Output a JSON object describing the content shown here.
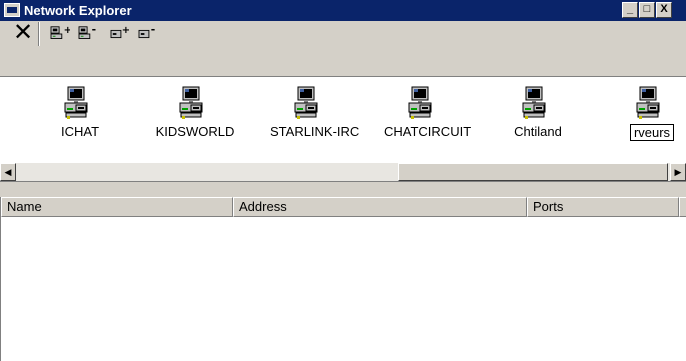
{
  "window": {
    "title": "Network Explorer",
    "minimize_label": "_",
    "maximize_label": "□",
    "close_label": "X"
  },
  "toolbar": {
    "close_label": "✕"
  },
  "servers": [
    {
      "label": "ICHAT"
    },
    {
      "label": "KIDSWORLD"
    },
    {
      "label": "STARLINK-IRC"
    },
    {
      "label": "CHATCIRCUIT"
    },
    {
      "label": "Chtiland"
    },
    {
      "label": "rveurs"
    }
  ],
  "scrollbar": {
    "left_arrow": "◀",
    "right_arrow": "▶"
  },
  "list": {
    "columns": [
      "Name",
      "Address",
      "Ports"
    ],
    "rows": []
  }
}
